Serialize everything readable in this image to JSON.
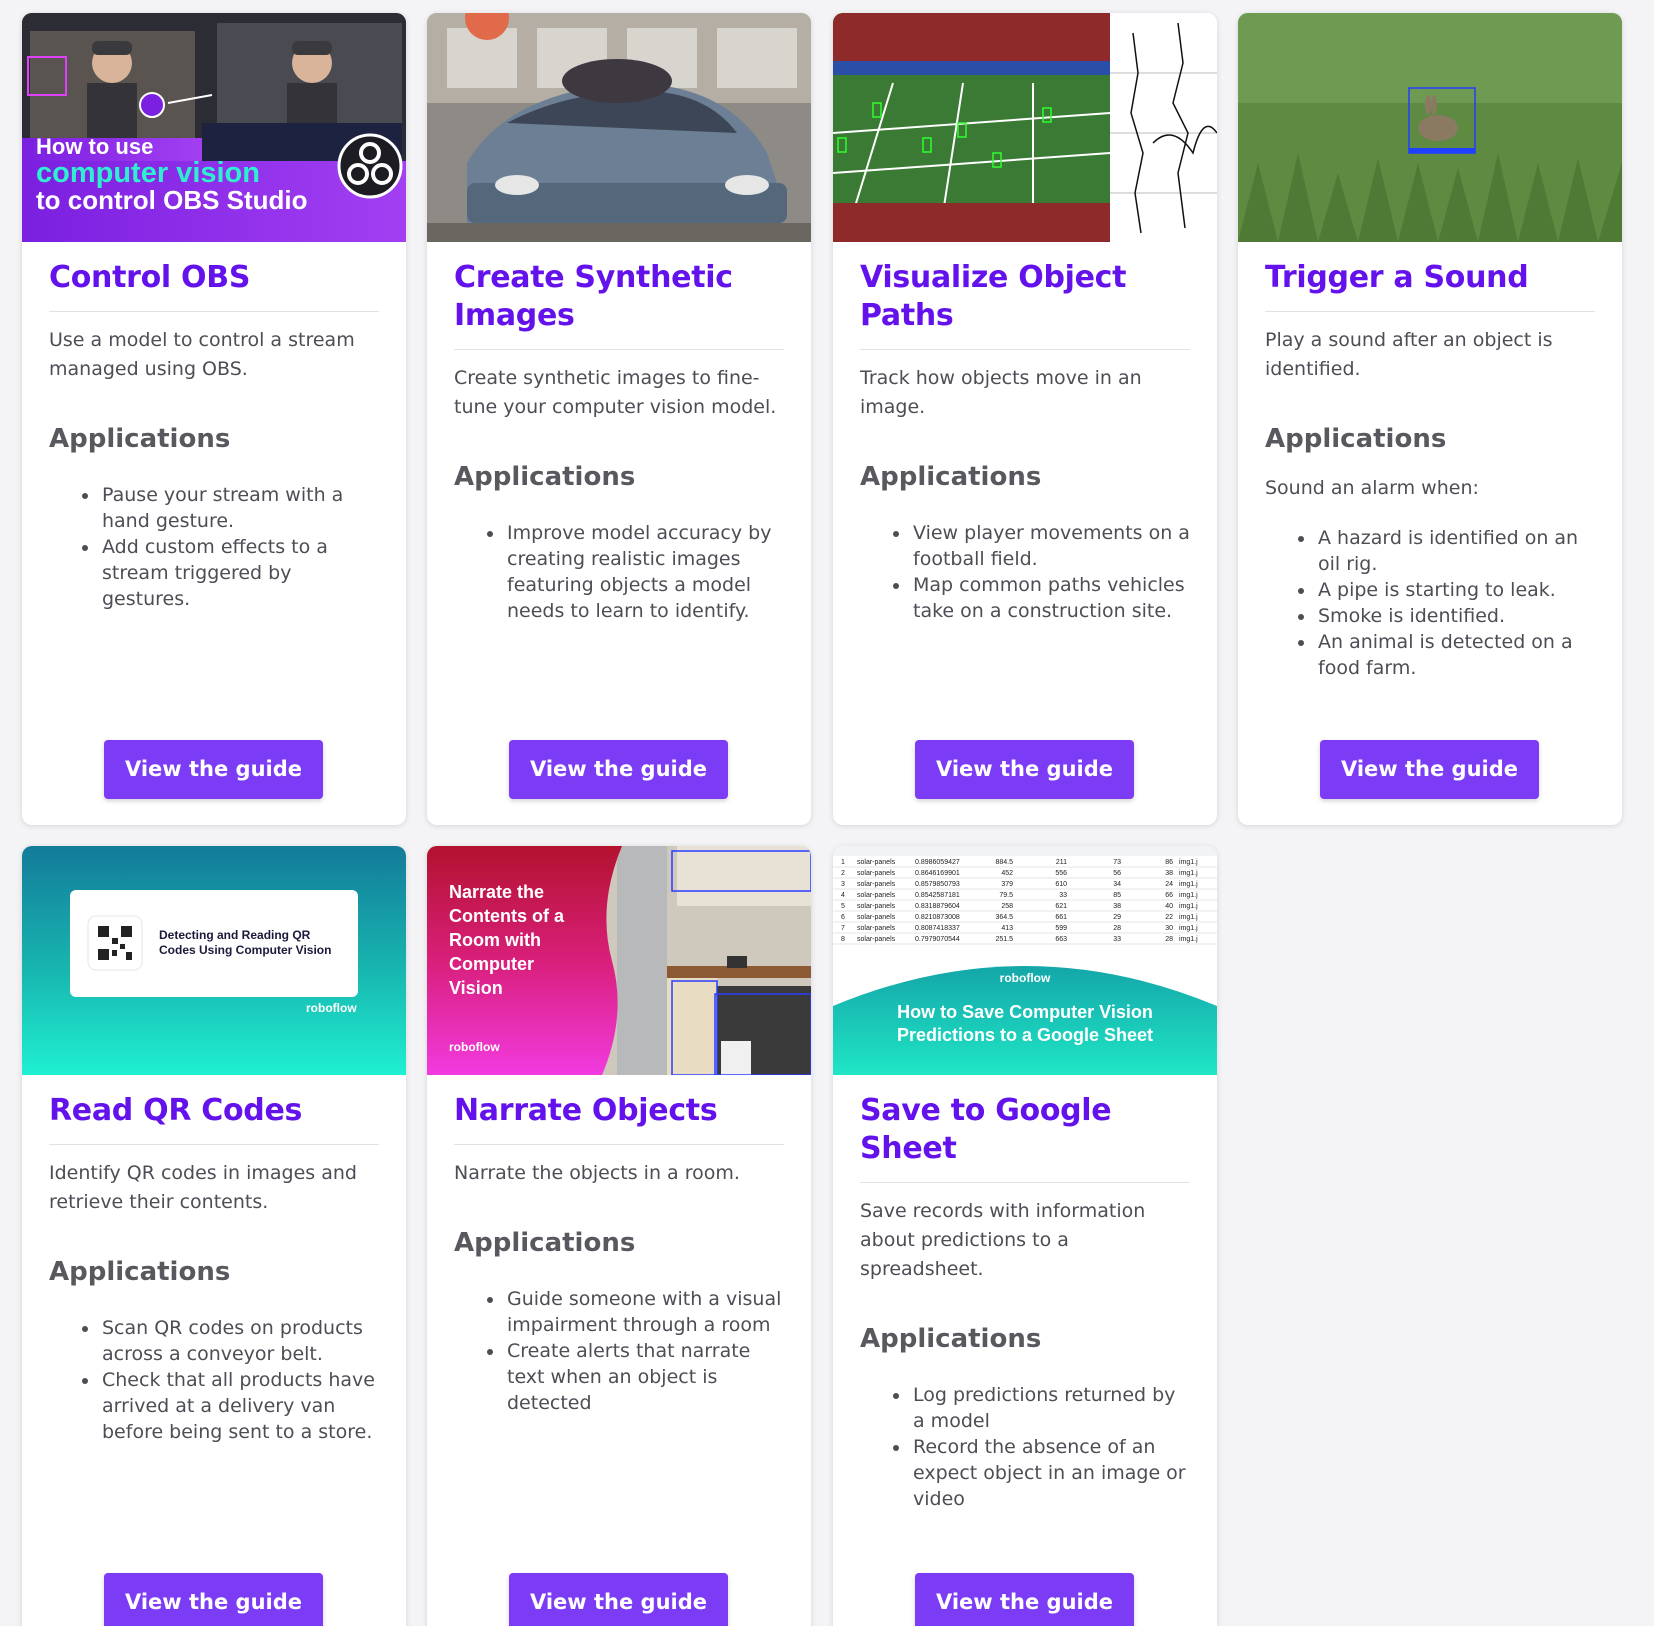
{
  "colors": {
    "accent": "#6312ec",
    "button": "#7c3bf4",
    "text": "#4d4d55",
    "heading": "#58585f",
    "background": "#f4f4f6"
  },
  "cards": [
    {
      "title": "Control OBS",
      "description": "Use a model to control a stream managed using OBS.",
      "applications_heading": "Applications",
      "bullets": [
        "Pause your stream with a hand gesture.",
        "Add custom effects to a stream triggered by gestures."
      ],
      "button": "View the guide",
      "thumbnail": {
        "line1": "How to use",
        "line2": "computer vision",
        "line3": "to control OBS Studio",
        "icon": "obs-logo-icon"
      }
    },
    {
      "title": "Create Synthetic Images",
      "description": "Create synthetic images to fine-tune your computer vision model.",
      "applications_heading": "Applications",
      "bullets": [
        "Improve model accuracy by creating realistic images featuring objects a model needs to learn to identify."
      ],
      "button": "View the guide"
    },
    {
      "title": "Visualize Object Paths",
      "description": "Track how objects move in an image.",
      "applications_heading": "Applications",
      "bullets": [
        "View player movements on a football field.",
        "Map common paths vehicles take on a construction site."
      ],
      "button": "View the guide"
    },
    {
      "title": "Trigger a Sound",
      "description": "Play a sound after an object is identified.",
      "applications_heading": "Applications",
      "intro": "Sound an alarm when:",
      "bullets": [
        "A hazard is identified on an oil rig.",
        "A pipe is starting to leak.",
        "Smoke is identified.",
        "An animal is detected on a food farm."
      ],
      "button": "View the guide"
    },
    {
      "title": "Read QR Codes",
      "description": "Identify QR codes in images and retrieve their contents.",
      "applications_heading": "Applications",
      "bullets": [
        "Scan QR codes on products across a conveyor belt.",
        "Check that all products have arrived at a delivery van before being sent to a store."
      ],
      "button": "View the guide",
      "thumbnail": {
        "line1": "Detecting and Reading QR",
        "line2": "Codes Using Computer Vision",
        "brand": "roboflow"
      }
    },
    {
      "title": "Narrate Objects",
      "description": "Narrate the objects in a room.",
      "applications_heading": "Applications",
      "bullets": [
        "Guide someone with a visual impairment through a room",
        "Create alerts that narrate text when an object is detected"
      ],
      "button": "View the guide",
      "thumbnail": {
        "lines": [
          "Narrate the",
          "Contents of a",
          "Room with",
          "Computer",
          "Vision"
        ],
        "brand": "roboflow"
      }
    },
    {
      "title": "Save to Google Sheet",
      "description": "Save records with information about predictions to a spreadsheet.",
      "applications_heading": "Applications",
      "bullets": [
        "Log predictions returned by a model",
        "Record the absence of an expect object in an image or video"
      ],
      "button": "View the guide",
      "thumbnail": {
        "line1": "How to Save Computer Vision",
        "line2": "Predictions to a Google Sheet",
        "brand": "roboflow",
        "sheet_rows": [
          [
            "1",
            "solar-panels",
            "0.8986059427",
            "884.5",
            "211",
            "73",
            "86",
            "img1.j"
          ],
          [
            "2",
            "solar-panels",
            "0.8646169901",
            "452",
            "556",
            "56",
            "38",
            "img1.j"
          ],
          [
            "3",
            "solar-panels",
            "0.8579850793",
            "379",
            "610",
            "34",
            "24",
            "img1.j"
          ],
          [
            "4",
            "solar-panels",
            "0.8542587181",
            "79.5",
            "33",
            "85",
            "66",
            "img1.j"
          ],
          [
            "5",
            "solar-panels",
            "0.8318879604",
            "258",
            "621",
            "38",
            "40",
            "img1.j"
          ],
          [
            "6",
            "solar-panels",
            "0.8210873008",
            "364.5",
            "661",
            "29",
            "22",
            "img1.j"
          ],
          [
            "7",
            "solar-panels",
            "0.8087418337",
            "413",
            "599",
            "28",
            "30",
            "img1.j"
          ],
          [
            "8",
            "solar-panels",
            "0.7979070544",
            "251.5",
            "663",
            "33",
            "28",
            "img1.j"
          ]
        ]
      }
    }
  ]
}
